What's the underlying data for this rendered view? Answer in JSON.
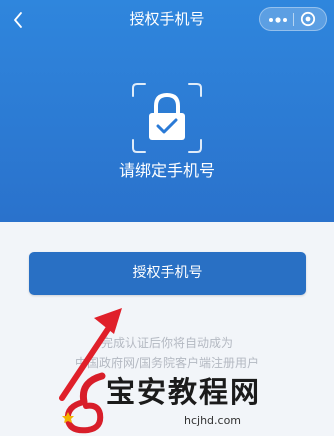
{
  "header": {
    "title": "授权手机号",
    "back_icon": "chevron-left-icon",
    "more_icon": "more-dots-icon",
    "close_icon": "close-ring-icon"
  },
  "hero": {
    "icon": "lock-check-icon",
    "text": "请绑定手机号"
  },
  "bind_button_label": "授权手机号",
  "notice_lines": [
    "完成认证后你将自动成为",
    "中国政府网/国务院客户端注册用户"
  ],
  "watermark": {
    "title": "宝安教程网",
    "url": "hcjhd.com"
  },
  "colors": {
    "hero_blue": "#2f86dd",
    "button_blue": "#2970c4",
    "background": "#f2f5f9",
    "arrow_red": "#e0202a"
  }
}
